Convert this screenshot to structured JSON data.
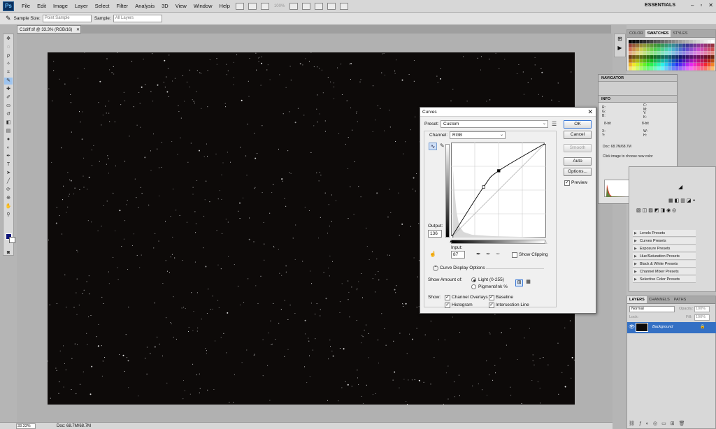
{
  "app": {
    "logo": "Ps",
    "workspace": "ESSENTIALS",
    "zoom_display": "100%"
  },
  "menu": [
    "File",
    "Edit",
    "Image",
    "Layer",
    "Select",
    "Filter",
    "Analysis",
    "3D",
    "View",
    "Window",
    "Help"
  ],
  "options_bar": {
    "sample_size_label": "Sample Size:",
    "sample_size_value": "Point Sample",
    "sample_label": "Sample:",
    "sample_value": "All Layers"
  },
  "document": {
    "tab_title": "C1diff.tif @ 33.3% (RGB/16)",
    "canvas_color": "#0d0a09"
  },
  "status": {
    "zoom": "33.33%",
    "doc": "Doc: 68.7M/68.7M"
  },
  "panels": {
    "swatches_tabs": [
      "COLOR",
      "SWATCHES",
      "STYLES"
    ],
    "navigator_tab": "NAVIGATOR",
    "info_tab": "INFO",
    "info": {
      "rgb": [
        "R:",
        "G:",
        "B:"
      ],
      "cmyk": [
        "C:",
        "M:",
        "Y:",
        "K:"
      ],
      "bits_left": "8-bit",
      "bits_right": "8-bit",
      "xy": [
        "X:",
        "Y:"
      ],
      "wh": [
        "W:",
        "H:"
      ],
      "doc": "Doc: 68.7M/68.7M",
      "hint": "Click image to choose new color"
    },
    "adjustment_presets": [
      "Levels Presets",
      "Curves Presets",
      "Exposure Presets",
      "Hue/Saturation Presets",
      "Black & White Presets",
      "Channel Mixer Presets",
      "Selective Color Presets"
    ],
    "layers_tabs": [
      "LAYERS",
      "CHANNELS",
      "PATHS"
    ],
    "blend_mode": "Normal",
    "opacity_label": "Opacity:",
    "opacity_value": "100%",
    "lock_label": "Lock:",
    "fill_label": "Fill:",
    "fill_value": "100%",
    "layer_name": "Background"
  },
  "curves": {
    "title": "Curves",
    "close": "✕",
    "preset_label": "Preset:",
    "preset_value": "Custom",
    "channel_label": "Channel:",
    "channel_value": "RGB",
    "buttons": {
      "ok": "OK",
      "cancel": "Cancel",
      "smooth": "Smooth",
      "auto": "Auto",
      "options": "Options..."
    },
    "preview_label": "Preview",
    "output_label": "Output:",
    "output_value": "136",
    "input_label": "Input:",
    "input_value": "87",
    "show_clipping_label": "Show Clipping",
    "display_options_label": "Curve Display Options",
    "show_amount_label": "Show Amount of:",
    "light_label": "Light  (0-255)",
    "pigment_label": "Pigment/Ink %",
    "show_label": "Show:",
    "channel_overlays_label": "Channel Overlays",
    "baseline_label": "Baseline",
    "histogram_label": "Histogram",
    "intersection_label": "Intersection Line",
    "curve_points": [
      [
        0,
        0
      ],
      [
        87,
        136
      ],
      [
        128,
        180
      ],
      [
        255,
        255
      ]
    ]
  }
}
